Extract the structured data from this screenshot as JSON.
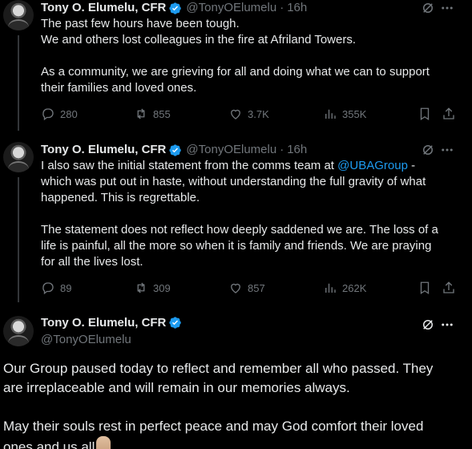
{
  "author": {
    "name": "Tony O. Elumelu, CFR",
    "handle": "@TonyOElumelu",
    "separator": "·"
  },
  "tweets": [
    {
      "time": "16h",
      "lines": [
        "The past few hours have been tough.",
        "We and others lost colleagues in the fire at Afriland Towers.",
        "",
        "As a community, we are grieving for all and doing what we can to support",
        "their families and loved ones."
      ],
      "replies": "280",
      "reposts": "855",
      "likes": "3.7K",
      "views": "355K"
    },
    {
      "time": "16h",
      "line1_pre": "I also saw the initial statement from the comms team at ",
      "mention": "@UBAGroup",
      "line1_post": " -",
      "lines": [
        "which was put out in haste, without understanding the full gravity of what",
        "happened. This is  regrettable.",
        "",
        "The statement does not reflect how deeply saddened we are. The loss of a",
        "life is painful, all the more so when it is family and friends. We are praying",
        "for all the lives lost."
      ],
      "replies": "89",
      "reposts": "309",
      "likes": "857",
      "views": "262K"
    }
  ],
  "main_tweet": {
    "lines": [
      "Our Group paused today to reflect and remember all who passed. They",
      "are irreplaceable and will remain in our memories always.",
      "",
      "May their souls rest in perfect peace and may God comfort their loved",
      "ones and us all"
    ],
    "emoji_icon": "folded-hands-emoji"
  },
  "colors": {
    "background": "#000000",
    "text": "#e7e9ea",
    "muted": "#71767b",
    "accent": "#1d9bf0"
  }
}
